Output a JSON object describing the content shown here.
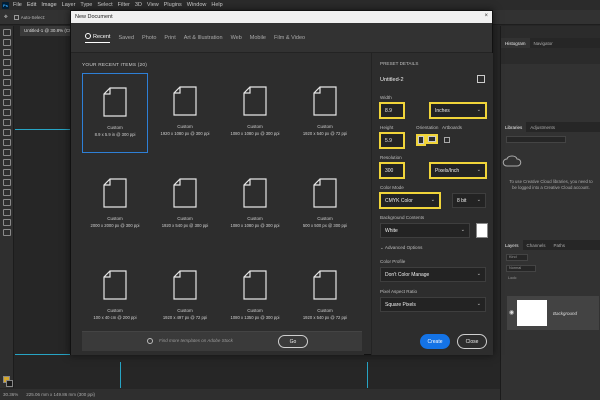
{
  "menu": {
    "logo": "Ps",
    "items": [
      "File",
      "Edit",
      "Image",
      "Layer",
      "Type",
      "Select",
      "Filter",
      "3D",
      "View",
      "Plugins",
      "Window",
      "Help"
    ]
  },
  "options_bar": {
    "auto_select": "Auto-Select:"
  },
  "doc_tab": {
    "label": "Untitled-1 @ 30.8% (CMY"
  },
  "status": {
    "zoom": "30.36%",
    "dims": "225.06 mm x 149.86 mm (300 ppi)"
  },
  "dialog": {
    "title": "New Document",
    "tabs": [
      "Recent",
      "Saved",
      "Photo",
      "Print",
      "Art & Illustration",
      "Web",
      "Mobile",
      "Film & Video"
    ],
    "recent_title": "YOUR RECENT ITEMS  (20)",
    "items": [
      {
        "name": "Custom",
        "dims": "8.9 x 5.9 in @ 300 ppi"
      },
      {
        "name": "Custom",
        "dims": "1920 x 1080 px @ 300 ppi"
      },
      {
        "name": "Custom",
        "dims": "1080 x 1080 px @ 300 ppi"
      },
      {
        "name": "Custom",
        "dims": "1920 x 540 px @ 72 ppi"
      },
      {
        "name": "Custom",
        "dims": "2000 x 2000 px @ 300 ppi"
      },
      {
        "name": "Custom",
        "dims": "1920 x 540 px @ 300 ppi"
      },
      {
        "name": "Custom",
        "dims": "1080 x 1080 px @ 300 ppi"
      },
      {
        "name": "Custom",
        "dims": "500 x 500 px @ 300 ppi"
      },
      {
        "name": "Custom",
        "dims": "100 x 40 cm @ 200 ppi"
      },
      {
        "name": "Custom",
        "dims": "1920 x 497 px @ 72 ppi"
      },
      {
        "name": "Custom",
        "dims": "1080 x 1350 px @ 300 ppi"
      },
      {
        "name": "Custom",
        "dims": "1920 x 540 px @ 72 ppi"
      }
    ],
    "search_placeholder": "Find more templates on Adobe Stock",
    "go_label": "Go",
    "create_label": "Create",
    "close_label": "Close"
  },
  "details": {
    "header": "PRESET DETAILS",
    "doc_name": "Untitled-2",
    "width_label": "Width",
    "width_value": "8.9",
    "width_unit": "Inches",
    "height_label": "Height",
    "height_value": "5.9",
    "orientation_label": "Orientation",
    "artboards_label": "Artboards",
    "resolution_label": "Resolution",
    "resolution_value": "300",
    "resolution_unit": "Pixels/Inch",
    "color_mode_label": "Color Mode",
    "color_mode_value": "CMYK Color",
    "bit_depth": "8 bit",
    "background_label": "Background Contents",
    "background_value": "White",
    "advanced_label": "Advanced Options",
    "profile_label": "Color Profile",
    "profile_value": "Don't Color Manage",
    "aspect_label": "Pixel Aspect Ratio",
    "aspect_value": "Square Pixels"
  },
  "right_panels": {
    "top_tabs": [
      "Histogram",
      "Navigator"
    ],
    "lib_tabs": [
      "Libraries",
      "Adjustments"
    ],
    "lib_message": "To use Creative Cloud libraries, you need to be logged into a Creative Cloud account.",
    "layer_tabs": [
      "Layers",
      "Channels",
      "Paths"
    ],
    "layer_kind": "Kind",
    "layer_mode": "Normal",
    "layer_lock": "Lock:",
    "layer_name": "Background"
  },
  "colors": {
    "highlight": "#f0d43a",
    "accent": "#1473e6",
    "guide": "#27a4c4"
  }
}
